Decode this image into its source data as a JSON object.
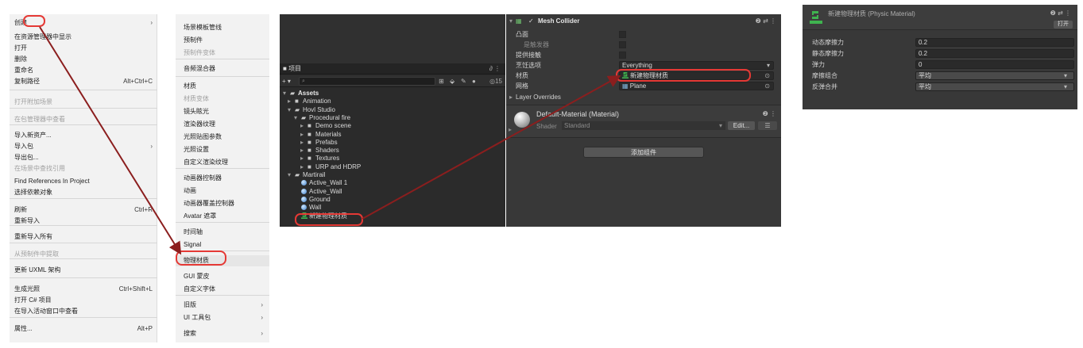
{
  "context_menu": {
    "items": [
      {
        "label": "创建",
        "shortcut": "",
        "arrow": true,
        "disabled": false
      },
      {
        "label": "在资源管理器中显示",
        "shortcut": "",
        "arrow": false,
        "disabled": false
      },
      {
        "label": "打开",
        "shortcut": "",
        "arrow": false,
        "disabled": false
      },
      {
        "label": "删除",
        "shortcut": "",
        "arrow": false,
        "disabled": false
      },
      {
        "label": "重命名",
        "shortcut": "",
        "arrow": false,
        "disabled": false
      },
      {
        "label": "复制路径",
        "shortcut": "Alt+Ctrl+C",
        "arrow": false,
        "disabled": false
      },
      {
        "label": "打开附加场景",
        "shortcut": "",
        "arrow": false,
        "disabled": true
      },
      {
        "label": "在包管理器中查看",
        "shortcut": "",
        "arrow": false,
        "disabled": true
      },
      {
        "label": "导入新资产...",
        "shortcut": "",
        "arrow": false,
        "disabled": false
      },
      {
        "label": "导入包",
        "shortcut": "",
        "arrow": true,
        "disabled": false
      },
      {
        "label": "导出包...",
        "shortcut": "",
        "arrow": false,
        "disabled": false
      },
      {
        "label": "在场景中查找引用",
        "shortcut": "",
        "arrow": false,
        "disabled": true
      },
      {
        "label": "Find References In Project",
        "shortcut": "",
        "arrow": false,
        "disabled": false
      },
      {
        "label": "选择依赖对象",
        "shortcut": "",
        "arrow": false,
        "disabled": false
      },
      {
        "label": "刷新",
        "shortcut": "Ctrl+R",
        "arrow": false,
        "disabled": false
      },
      {
        "label": "重新导入",
        "shortcut": "",
        "arrow": false,
        "disabled": false
      },
      {
        "label": "重新导入所有",
        "shortcut": "",
        "arrow": false,
        "disabled": false
      },
      {
        "label": "从预制件中提取",
        "shortcut": "",
        "arrow": false,
        "disabled": true
      },
      {
        "label": "更新 UXML 架构",
        "shortcut": "",
        "arrow": false,
        "disabled": false
      },
      {
        "label": "生成光照",
        "shortcut": "Ctrl+Shift+L",
        "arrow": false,
        "disabled": false
      },
      {
        "label": "打开 C# 项目",
        "shortcut": "",
        "arrow": false,
        "disabled": false
      },
      {
        "label": "在导入活动窗口中查看",
        "shortcut": "",
        "arrow": false,
        "disabled": false
      },
      {
        "label": "属性...",
        "shortcut": "Alt+P",
        "arrow": false,
        "disabled": false
      }
    ]
  },
  "sub_menu": {
    "items": [
      {
        "label": "场景模板管线",
        "arrow": false,
        "disabled": false
      },
      {
        "label": "预制件",
        "arrow": false,
        "disabled": false
      },
      {
        "label": "预制件变体",
        "arrow": false,
        "disabled": true
      },
      {
        "label": "音频混合器",
        "arrow": false,
        "disabled": false
      },
      {
        "label": "材质",
        "arrow": false,
        "disabled": false
      },
      {
        "label": "材质变体",
        "arrow": false,
        "disabled": true
      },
      {
        "label": "镜头眩光",
        "arrow": false,
        "disabled": false
      },
      {
        "label": "渲染器纹理",
        "arrow": false,
        "disabled": false
      },
      {
        "label": "光照贴图参数",
        "arrow": false,
        "disabled": false
      },
      {
        "label": "光照设置",
        "arrow": false,
        "disabled": false
      },
      {
        "label": "自定义渲染纹理",
        "arrow": false,
        "disabled": false
      },
      {
        "label": "动画器控制器",
        "arrow": false,
        "disabled": false
      },
      {
        "label": "动画",
        "arrow": false,
        "disabled": false
      },
      {
        "label": "动画器覆盖控制器",
        "arrow": false,
        "disabled": false
      },
      {
        "label": "Avatar 遮罩",
        "arrow": false,
        "disabled": false
      },
      {
        "label": "时间轴",
        "arrow": false,
        "disabled": false
      },
      {
        "label": "Signal",
        "arrow": false,
        "disabled": false
      },
      {
        "label": "物理材质",
        "arrow": false,
        "disabled": false
      },
      {
        "label": "GUI 蒙皮",
        "arrow": false,
        "disabled": false
      },
      {
        "label": "自定义字体",
        "arrow": false,
        "disabled": false
      },
      {
        "label": "旧版",
        "arrow": true,
        "disabled": false
      },
      {
        "label": "UI 工具包",
        "arrow": true,
        "disabled": false
      },
      {
        "label": "搜索",
        "arrow": true,
        "disabled": false
      }
    ]
  },
  "project_panel": {
    "tab_label": "项目",
    "search_placeholder": "",
    "count": "15",
    "tree": [
      {
        "label": "Assets",
        "type": "folder",
        "bold": true
      },
      {
        "label": "Animation",
        "type": "folder"
      },
      {
        "label": "Hovl Studio",
        "type": "folder"
      },
      {
        "label": "Procedural fire",
        "type": "folder"
      },
      {
        "label": "Demo scene",
        "type": "folder"
      },
      {
        "label": "Materials",
        "type": "folder"
      },
      {
        "label": "Prefabs",
        "type": "folder"
      },
      {
        "label": "Shaders",
        "type": "folder"
      },
      {
        "label": "Textures",
        "type": "folder"
      },
      {
        "label": "URP and HDRP",
        "type": "folder"
      },
      {
        "label": "Martirail",
        "type": "folder"
      },
      {
        "label": "Active_Wall 1",
        "type": "sphere"
      },
      {
        "label": "Active_Wall",
        "type": "sphere"
      },
      {
        "label": "Ground",
        "type": "sphere"
      },
      {
        "label": "Wall",
        "type": "sphere"
      },
      {
        "label": "新建物理材质",
        "type": "physic"
      }
    ]
  },
  "inspector": {
    "component_title": "Mesh Collider",
    "rows": [
      {
        "label": "凸面",
        "kind": "checkbox",
        "value": ""
      },
      {
        "label": "是触发器",
        "kind": "checkbox-dim",
        "value": ""
      },
      {
        "label": "提供接触",
        "kind": "checkbox",
        "value": ""
      },
      {
        "label": "烹饪选项",
        "kind": "dropdown",
        "value": "Everything"
      },
      {
        "label": "材质",
        "kind": "object-physic",
        "value": "新建物理材质"
      },
      {
        "label": "网格",
        "kind": "object-mesh",
        "value": "Plane"
      },
      {
        "label": "Layer Overrides",
        "kind": "foldout",
        "value": ""
      }
    ],
    "material": {
      "name": "Default-Material (Material)",
      "shader_label": "Shader",
      "shader_value": "Standard",
      "edit_label": "Edit...",
      "small_dd": "☰"
    },
    "add_component_label": "添加组件"
  },
  "physic_material": {
    "title": "新建物理材质 (Physic Material)",
    "open_label": "打开",
    "rows": [
      {
        "label": "动态摩擦力",
        "value": "0.2",
        "dropdown": false
      },
      {
        "label": "静态摩擦力",
        "value": "0.2",
        "dropdown": false
      },
      {
        "label": "弹力",
        "value": "0",
        "dropdown": false
      },
      {
        "label": "摩擦组合",
        "value": "平均",
        "dropdown": true
      },
      {
        "label": "反弹合并",
        "value": "平均",
        "dropdown": true
      }
    ]
  },
  "colors": {
    "annotation_red": "#e53935",
    "arrow_dark_red": "#8b1e1e",
    "physic_icon_green": "#3fb34f"
  }
}
